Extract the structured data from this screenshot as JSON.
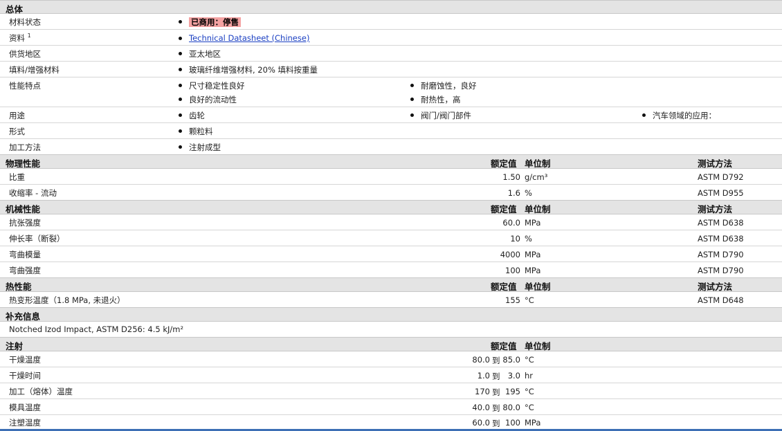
{
  "sections": {
    "general": "总体",
    "physical": "物理性能",
    "mechanical": "机械性能",
    "thermal": "热性能",
    "supplemental": "补充信息",
    "injection": "注射"
  },
  "headers": {
    "value": "额定值",
    "unit": "单位制",
    "method": "测试方法"
  },
  "general": {
    "status_label": "材料状态",
    "status_value": "已商用：停售",
    "docs_label": "资料",
    "docs_sup": "1",
    "docs_link": "Technical Datasheet (Chinese)",
    "region_label": "供货地区",
    "region_value": "亚太地区",
    "filler_label": "填料/增强材料",
    "filler_value": "玻璃纤维增强材料, 20% 填料按重量",
    "features_label": "性能特点",
    "features": [
      "尺寸稳定性良好",
      "耐磨蚀性，良好",
      "良好的流动性",
      "耐热性，高"
    ],
    "uses_label": "用途",
    "uses": [
      "齿轮",
      "阀门/阀门部件",
      "汽车领域的应用："
    ],
    "form_label": "形式",
    "form_value": "颗粒料",
    "process_label": "加工方法",
    "process_value": "注射成型"
  },
  "physical": [
    {
      "name": "比重",
      "value": "1.50",
      "unit": "g/cm³",
      "method": "ASTM D792"
    },
    {
      "name": "收缩率 - 流动",
      "value": "1.6",
      "unit": "%",
      "method": "ASTM D955"
    }
  ],
  "mechanical": [
    {
      "name": "抗张强度",
      "value": "60.0",
      "unit": "MPa",
      "method": "ASTM D638"
    },
    {
      "name": "伸长率（断裂）",
      "value": "10",
      "unit": "%",
      "method": "ASTM D638"
    },
    {
      "name": "弯曲模量",
      "value": "4000",
      "unit": "MPa",
      "method": "ASTM D790"
    },
    {
      "name": "弯曲强度",
      "value": "100",
      "unit": "MPa",
      "method": "ASTM D790"
    }
  ],
  "thermal": [
    {
      "name": "热变形温度（1.8 MPa, 未退火）",
      "value": "155",
      "unit": "°C",
      "method": "ASTM D648"
    }
  ],
  "supplemental_text": "Notched Izod Impact, ASTM D256: 4.5 kJ/m²",
  "injection": [
    {
      "name": "干燥温度",
      "low": "80.0",
      "to": "到",
      "high": "85.0",
      "unit": "°C"
    },
    {
      "name": "干燥时间",
      "low": "1.0",
      "to": "到",
      "high": "3.0",
      "unit": "hr"
    },
    {
      "name": "加工（熔体）温度",
      "low": "170",
      "to": "到",
      "high": "195",
      "unit": "°C"
    },
    {
      "name": "模具温度",
      "low": "40.0",
      "to": "到",
      "high": "80.0",
      "unit": "°C"
    },
    {
      "name": "注塑温度",
      "low": "60.0",
      "to": "到",
      "high": "100",
      "unit": "MPa"
    }
  ]
}
